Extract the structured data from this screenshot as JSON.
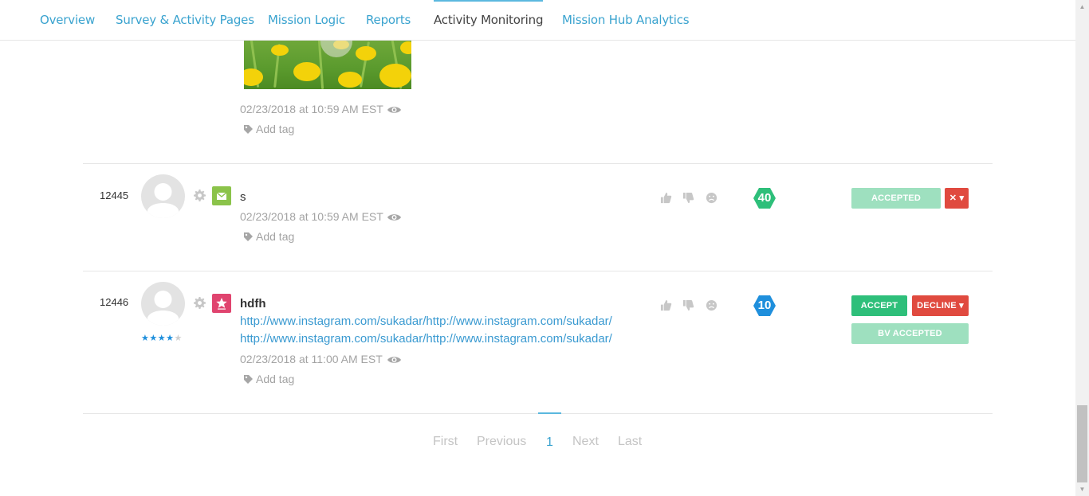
{
  "nav": {
    "tabs": [
      {
        "label": "Overview"
      },
      {
        "label": "Survey & Activity Pages"
      },
      {
        "label": "Mission Logic"
      },
      {
        "label": "Reports"
      },
      {
        "label": "Activity Monitoring",
        "active": true
      },
      {
        "label": "Mission Hub Analytics"
      }
    ]
  },
  "colors": {
    "link": "#3aa3cf",
    "accept_green": "#2ebf7a",
    "accepted_light_green": "#9ee0bf",
    "decline_red": "#e04a3f",
    "badge_green": "#2ebf7a",
    "badge_blue": "#1f8fdc"
  },
  "activities": [
    {
      "timestamp": "02/23/2018 at 10:59 AM EST",
      "add_tag": "Add tag",
      "image": "dandelion-field-photo"
    },
    {
      "id": "12445",
      "type_icon": "envelope-icon",
      "title": "s",
      "timestamp": "02/23/2018 at 10:59 AM EST",
      "add_tag": "Add tag",
      "points": "40",
      "status_button": "ACCEPTED",
      "menu_button": "✕ ▾"
    },
    {
      "id": "12446",
      "type_icon": "star-icon",
      "rating": 4,
      "rating_max": 5,
      "title": "hdfh",
      "links": [
        "http://www.instagram.com/sukadar/http://www.instagram.com/sukadar/",
        "http://www.instagram.com/sukadar/http://www.instagram.com/sukadar/"
      ],
      "timestamp": "02/23/2018 at 11:00 AM EST",
      "add_tag": "Add tag",
      "points": "10",
      "accept_button": "ACCEPT",
      "decline_button": "DECLINE ▾",
      "bv_button": "BV ACCEPTED"
    }
  ],
  "pagination": {
    "first": "First",
    "previous": "Previous",
    "current": "1",
    "next": "Next",
    "last": "Last"
  }
}
